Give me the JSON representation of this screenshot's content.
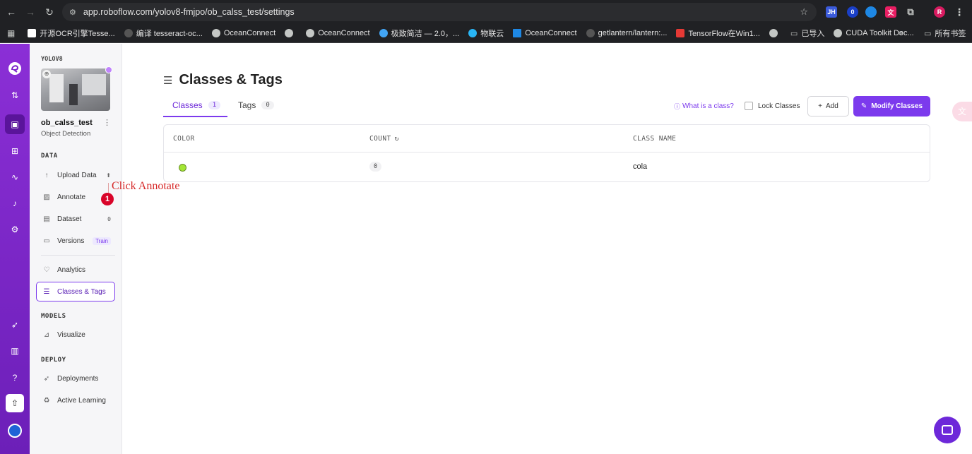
{
  "browser": {
    "url": "app.roboflow.com/yolov8-fmjpo/ob_calss_test/settings",
    "bookmarks": [
      "开源OCR引擎Tesse...",
      "编译 tesseract-oc...",
      "OceanConnect",
      "",
      "OceanConnect",
      "极致简洁 — 2.0，...",
      "物联云",
      "OceanConnect",
      "getlantern/lantern:...",
      "TensorFlow在Win1...",
      "",
      "已导入",
      "CUDA Toolkit Doc..."
    ],
    "all_bookmarks": "所有书签"
  },
  "sidebar": {
    "workspace": "YOLOV8",
    "project_name": "ob_calss_test",
    "project_type": "Object Detection",
    "data_header": "DATA",
    "items_data": [
      {
        "label": "Upload Data",
        "icon": "upload-icon"
      },
      {
        "label": "Annotate",
        "icon": "annotate-icon"
      },
      {
        "label": "Dataset",
        "icon": "dataset-icon",
        "badge": "0"
      },
      {
        "label": "Versions",
        "icon": "versions-icon",
        "badge": "Train"
      },
      {
        "label": "Analytics",
        "icon": "analytics-icon"
      },
      {
        "label": "Classes & Tags",
        "icon": "classes-icon"
      }
    ],
    "models_header": "MODELS",
    "visualize": "Visualize",
    "deploy_header": "DEPLOY",
    "deployments": "Deployments",
    "active_learning": "Active Learning"
  },
  "annotation": {
    "text": "Click Annotate",
    "step": "1"
  },
  "main": {
    "title": "Classes & Tags",
    "tabs": [
      {
        "label": "Classes",
        "count": "1"
      },
      {
        "label": "Tags",
        "count": "0"
      }
    ],
    "help_link": "What is a class?",
    "lock_label": "Lock Classes",
    "add_label": "Add",
    "modify_label": "Modify Classes",
    "columns": [
      "COLOR",
      "COUNT",
      "CLASS NAME"
    ],
    "rows": [
      {
        "color": "#a3e635",
        "count": "0",
        "name": "cola"
      }
    ]
  },
  "colors": {
    "accent": "#7c3aed",
    "rail": "#7c22c9"
  }
}
